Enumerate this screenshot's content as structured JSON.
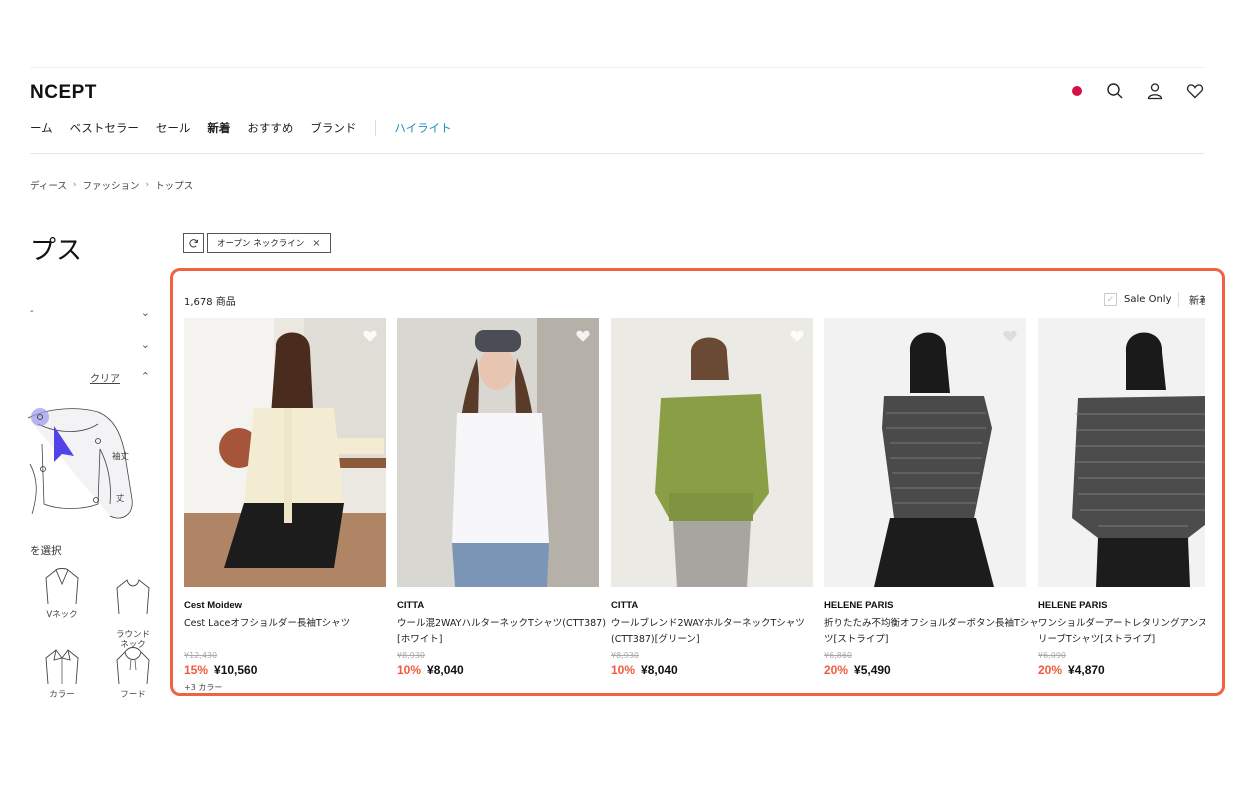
{
  "header": {
    "logo": "NCEPT",
    "icons": [
      "notification-dot",
      "search-icon",
      "account-icon",
      "heart-icon"
    ]
  },
  "nav": {
    "items": [
      "ーム",
      "ベストセラー",
      "セール",
      "新着",
      "おすすめ",
      "ブランド"
    ],
    "highlight": "ハイライト"
  },
  "breadcrumb": [
    "ディース",
    "ファッション",
    "トップス"
  ],
  "page_title": "プス",
  "filters": {
    "row1_label": "-",
    "clear_label": "クリア",
    "neck_select_label": "を選択",
    "illus_labels": {
      "sleeve": "袖丈",
      "length": "丈"
    },
    "neck_options": [
      {
        "label": "Vネック"
      },
      {
        "label": "ラウンド\nネック"
      },
      {
        "label": "カラー"
      },
      {
        "label": "フード"
      }
    ]
  },
  "active_chip": "オープン ネックライン",
  "product_count": "1,678 商品",
  "sale_only_label": "Sale Only",
  "sort_label": "新着",
  "products": [
    {
      "brand": "Cest Moidew",
      "name": "Cest Laceオフショルダー長袖Tシャツ",
      "orig": "¥12,430",
      "discount": "15%",
      "price": "¥10,560",
      "colors": "+3 カラー",
      "bg": "#e8e4dc"
    },
    {
      "brand": "CITTA",
      "name": "ウール混2WAYハルターネックTシャツ(CTT387)[ホワイト]",
      "orig": "¥8,930",
      "discount": "10%",
      "price": "¥8,040",
      "colors": "",
      "bg": "#d8d6d2"
    },
    {
      "brand": "CITTA",
      "name": "ウールブレンド2WAYホルターネックTシャツ(CTT387)[グリーン]",
      "orig": "¥8,930",
      "discount": "10%",
      "price": "¥8,040",
      "colors": "",
      "bg": "#ece9e2"
    },
    {
      "brand": "HELENE PARIS",
      "name": "折りたたみ不均衡オフショルダーボタン長袖Tシャツ[ストライプ]",
      "orig": "¥6,860",
      "discount": "20%",
      "price": "¥5,490",
      "colors": "",
      "bg": "#f3f3f3"
    },
    {
      "brand": "HELENE PARIS",
      "name": "ワンショルダーアートレタリングアンスロングスリーブTシャツ[ストライプ]",
      "orig": "¥6,090",
      "discount": "20%",
      "price": "¥4,870",
      "colors": "",
      "bg": "#f3f3f3"
    }
  ]
}
